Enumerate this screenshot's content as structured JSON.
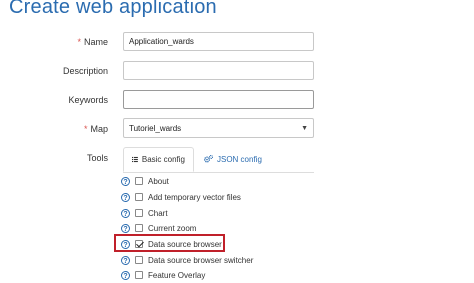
{
  "page": {
    "title": "Create web application"
  },
  "form": {
    "name_label": "Name",
    "name_required": "*",
    "name_value": "Application_wards",
    "description_label": "Description",
    "description_value": "",
    "keywords_label": "Keywords",
    "keywords_value": "",
    "map_label": "Map",
    "map_required": "*",
    "map_value": "Tutoriel_wards",
    "tools_label": "Tools"
  },
  "tabs": [
    {
      "label": "Basic config",
      "icon": "list-icon",
      "active": true
    },
    {
      "label": "JSON config",
      "icon": "gears-icon",
      "active": false
    }
  ],
  "tools": [
    {
      "label": "About",
      "checked": false
    },
    {
      "label": "Add temporary vector files",
      "checked": false
    },
    {
      "label": "Chart",
      "checked": false
    },
    {
      "label": "Current zoom",
      "checked": false
    },
    {
      "label": "Data source browser",
      "checked": true,
      "highlighted": true
    },
    {
      "label": "Data source browser switcher",
      "checked": false
    },
    {
      "label": "Feature Overlay",
      "checked": false
    }
  ],
  "help_glyph": "?",
  "colors": {
    "accent": "#2b6cb0",
    "highlight": "#c0202a",
    "required": "#d9534f"
  }
}
